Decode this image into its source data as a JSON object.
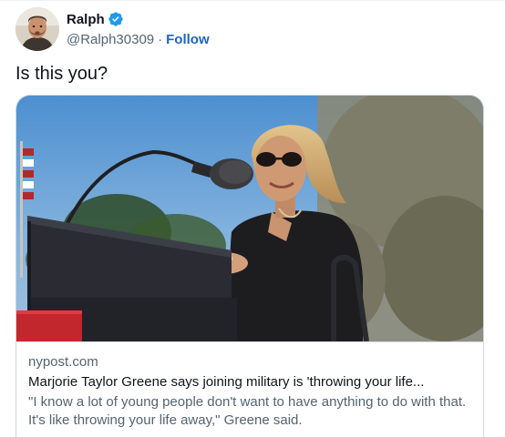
{
  "tweet": {
    "author": {
      "name": "Ralph",
      "handle": "@Ralph30309",
      "verified": true,
      "follow_label": "Follow",
      "separator": "·"
    },
    "text": "Is this you?"
  },
  "card": {
    "domain": "nypost.com",
    "title": "Marjorie Taylor Greene says joining military is 'throwing your life...",
    "description": "\"I know a lot of young people don't want to have anything to do with that. It's like throwing your life away,\" Greene said.",
    "image_icon": "photo-of-speaker-at-podium"
  },
  "colors": {
    "link_blue": "#1d64c8",
    "verified_blue": "#1d9bf0",
    "muted_text": "#536471",
    "border": "#cfd9de"
  }
}
